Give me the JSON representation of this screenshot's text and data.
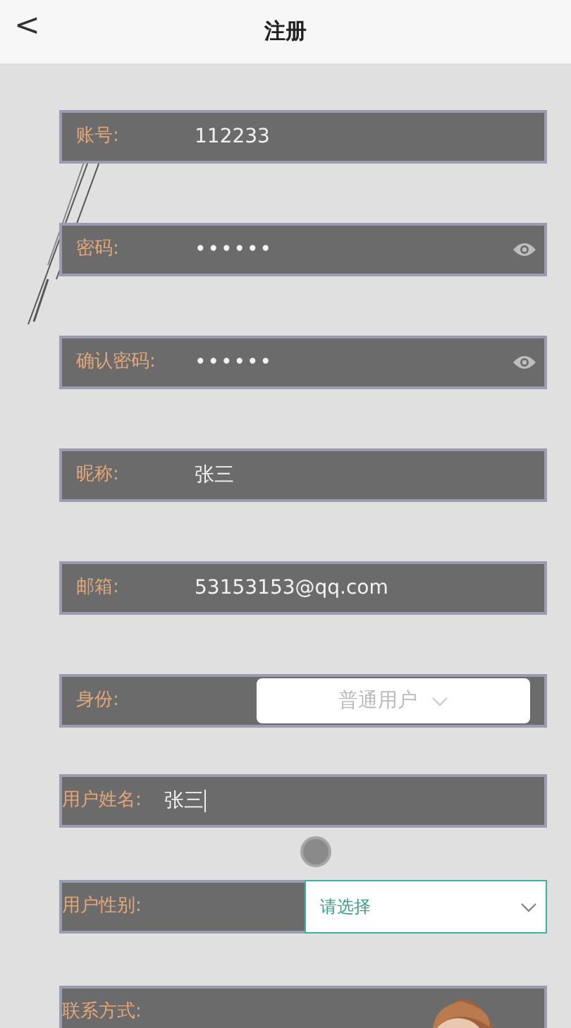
{
  "header": {
    "back": "<",
    "title": "注册"
  },
  "rows": [
    {
      "kind": "text",
      "label": "账号:",
      "value": "112233"
    },
    {
      "kind": "password",
      "label": "密码:",
      "value": "••••••"
    },
    {
      "kind": "password",
      "label": "确认密码:",
      "value": "••••••"
    },
    {
      "kind": "text",
      "label": "昵称:",
      "value": "张三"
    },
    {
      "kind": "text",
      "label": "邮箱:",
      "value": "53153153@qq.com"
    },
    {
      "kind": "pill-select",
      "label": "身份:",
      "value": "普通用户"
    },
    {
      "kind": "text-focused",
      "label": "用户姓名:",
      "value": "张三"
    },
    {
      "kind": "select",
      "label": "用户性别:",
      "placeholder": "请选择"
    },
    {
      "kind": "label-only",
      "label": "联系方式:"
    }
  ]
}
